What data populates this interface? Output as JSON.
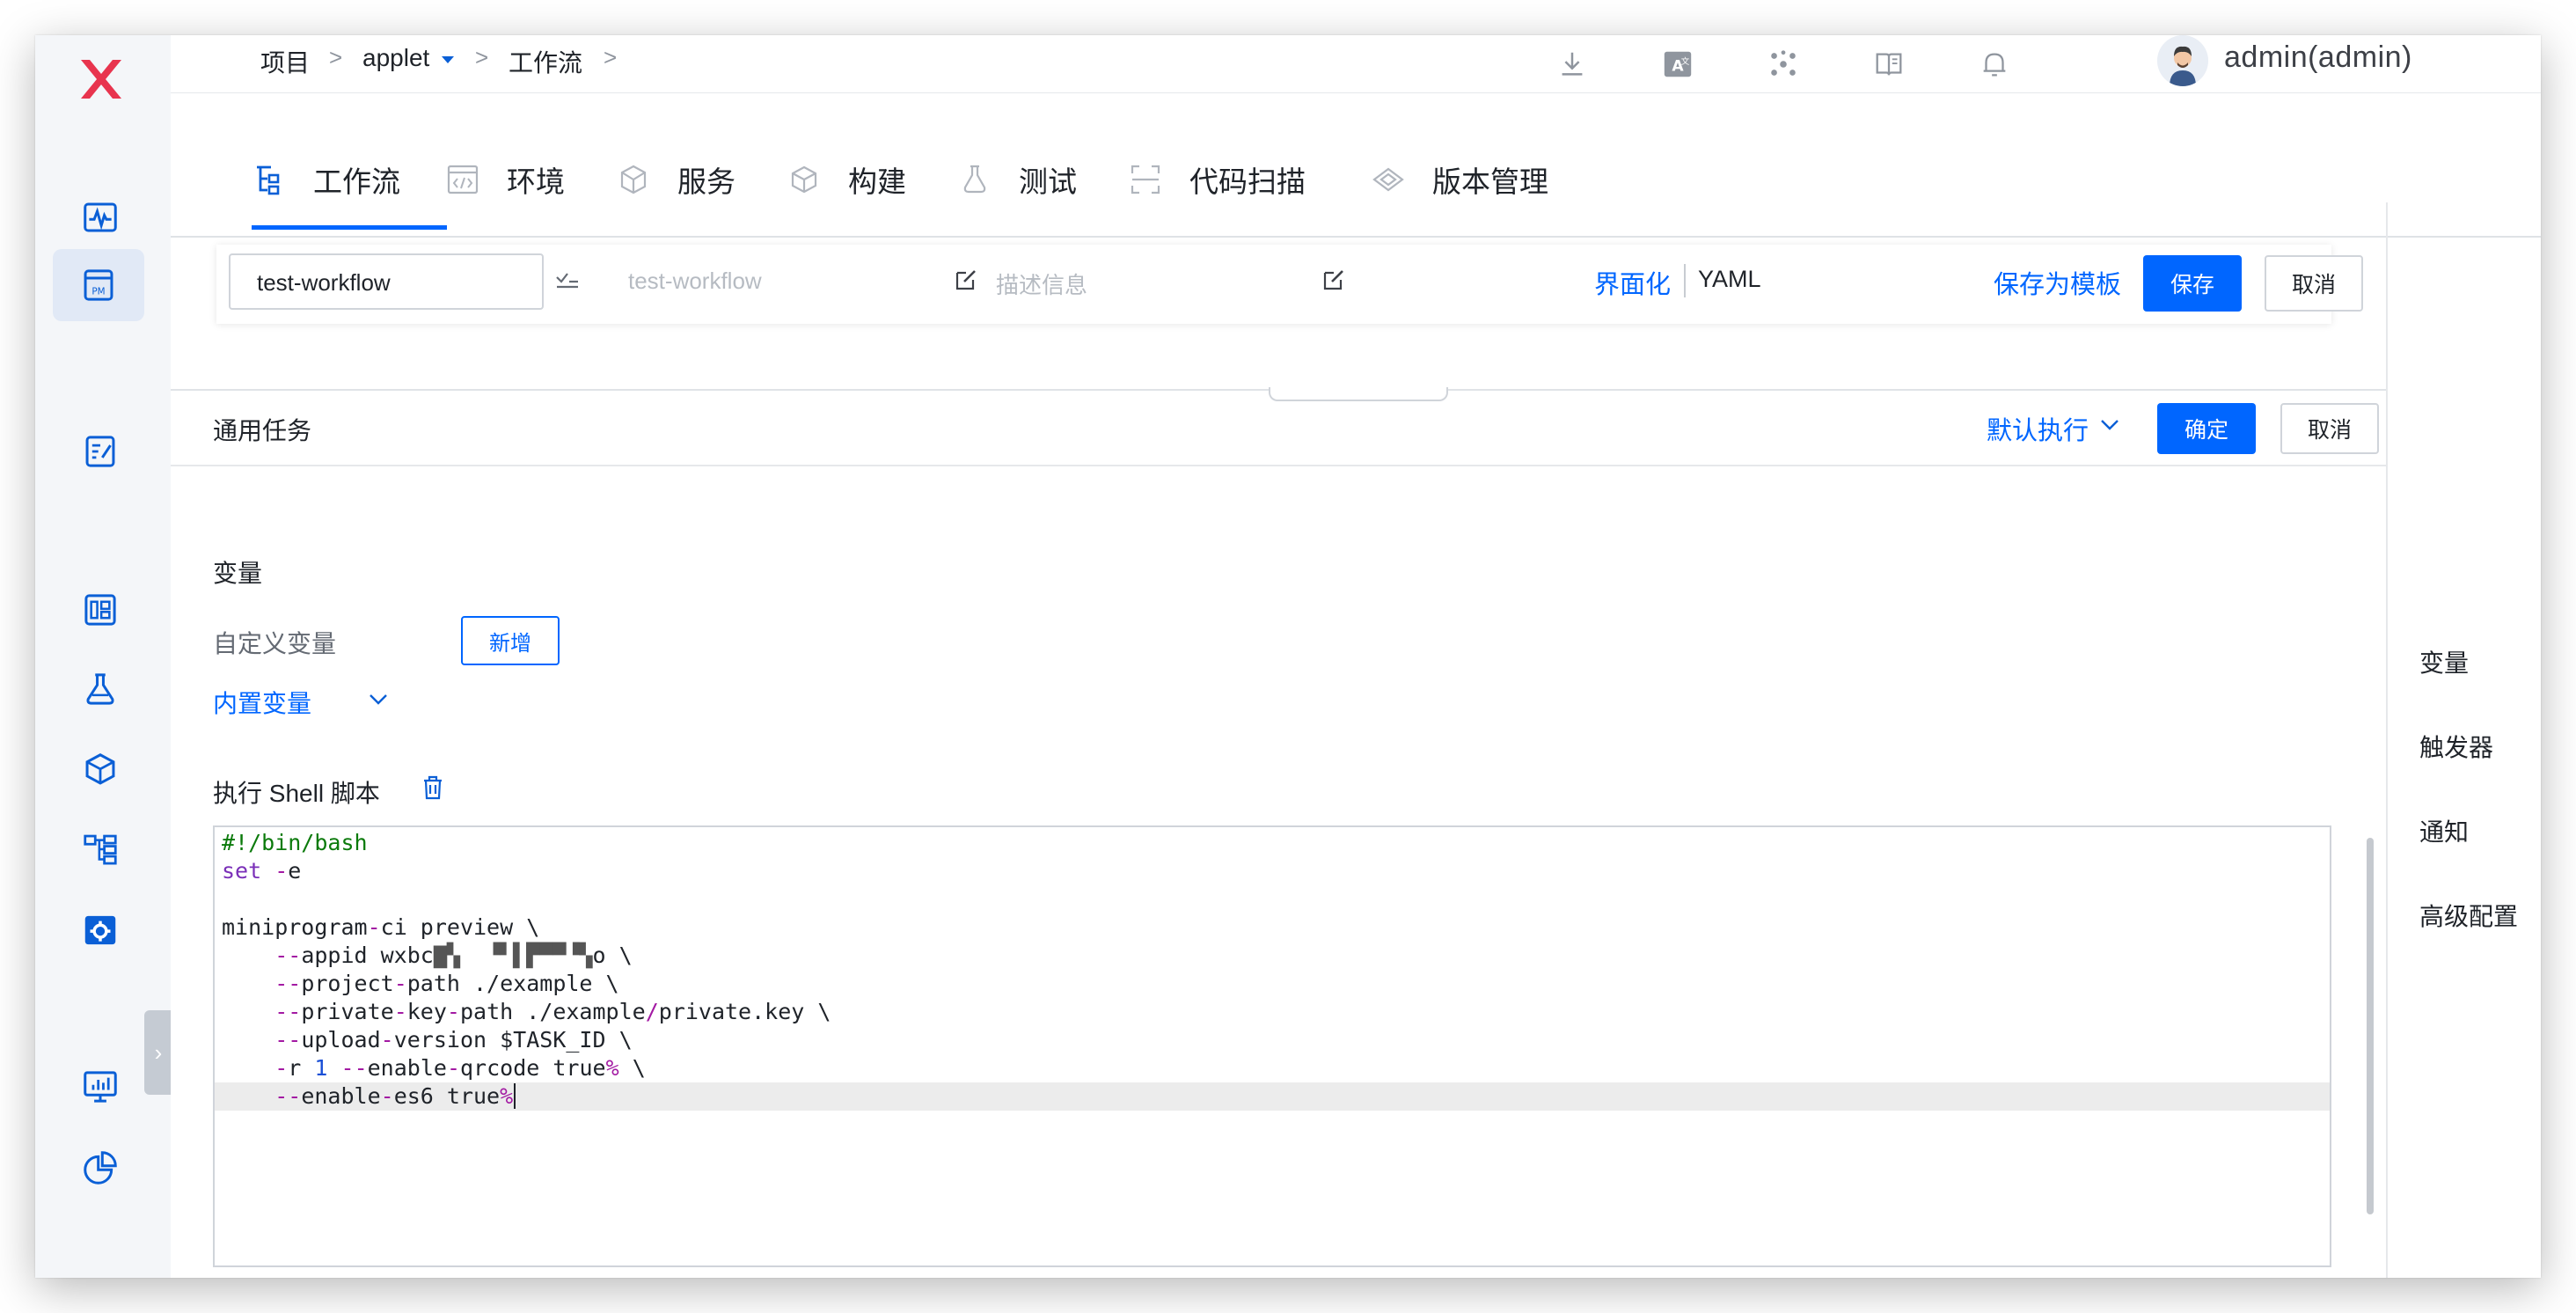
{
  "breadcrumb": {
    "root": "项目",
    "sep1": ">",
    "project": "applet",
    "sep2": ">",
    "section": "工作流",
    "sep3": ">"
  },
  "topbar": {
    "user": "admin(admin)",
    "kebab": "⋮"
  },
  "rail": {
    "toggle_glyph": "›"
  },
  "modnav": {
    "tabs": [
      {
        "label": "工作流"
      },
      {
        "label": "环境"
      },
      {
        "label": "服务"
      },
      {
        "label": "构建"
      },
      {
        "label": "测试"
      },
      {
        "label": "代码扫描"
      },
      {
        "label": "版本管理"
      }
    ]
  },
  "workflow": {
    "name_value": "test-workflow",
    "display_name_placeholder": "test-workflow",
    "description_placeholder": "描述信息",
    "mode_ui": "界面化",
    "mode_yaml": "YAML",
    "save_as_template": "保存为模板",
    "save": "保存",
    "cancel": "取消"
  },
  "task": {
    "title": "通用任务",
    "run_policy": "默认执行",
    "confirm": "确定",
    "cancel": "取消",
    "variables_title": "变量",
    "custom_variables_label": "自定义变量",
    "add_button": "新增",
    "builtin_variables": "内置变量",
    "shell_title": "执行 Shell 脚本"
  },
  "script": {
    "lines": [
      "#!/bin/bash",
      "set -e",
      "",
      "miniprogram-ci preview \\",
      "    --appid wxbc▇▚  ▝▘▌▛▀▀▝▚o \\",
      "    --project-path ./example \\",
      "    --private-key-path ./example/private.key \\",
      "    --upload-version $TASK_ID \\",
      "    -r 1 --enable-qrcode true% \\",
      "    --enable-es6 true%"
    ]
  },
  "right_panel": {
    "items": [
      "变量",
      "触发器",
      "通知",
      "高级配置"
    ]
  },
  "colors": {
    "accent": "#0066ff",
    "brand_logo": "#e8344e",
    "rail_bg": "#f4f6f9"
  }
}
